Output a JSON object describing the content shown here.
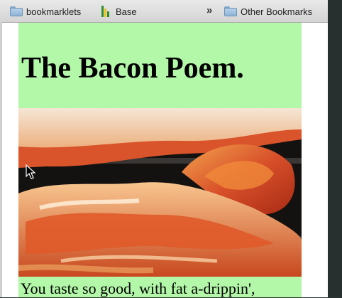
{
  "bookmarks": {
    "items": [
      {
        "label": "bookmarklets",
        "icon": "folder-icon"
      },
      {
        "label": "Base",
        "icon": "bar-chart-icon"
      }
    ],
    "overflow_label": "»",
    "other_label": "Other Bookmarks",
    "other_icon": "folder-icon"
  },
  "page": {
    "title": "The Bacon Poem.",
    "first_line": "You taste so good, with fat a-drippin',",
    "background_color": "#b3f7a8"
  }
}
